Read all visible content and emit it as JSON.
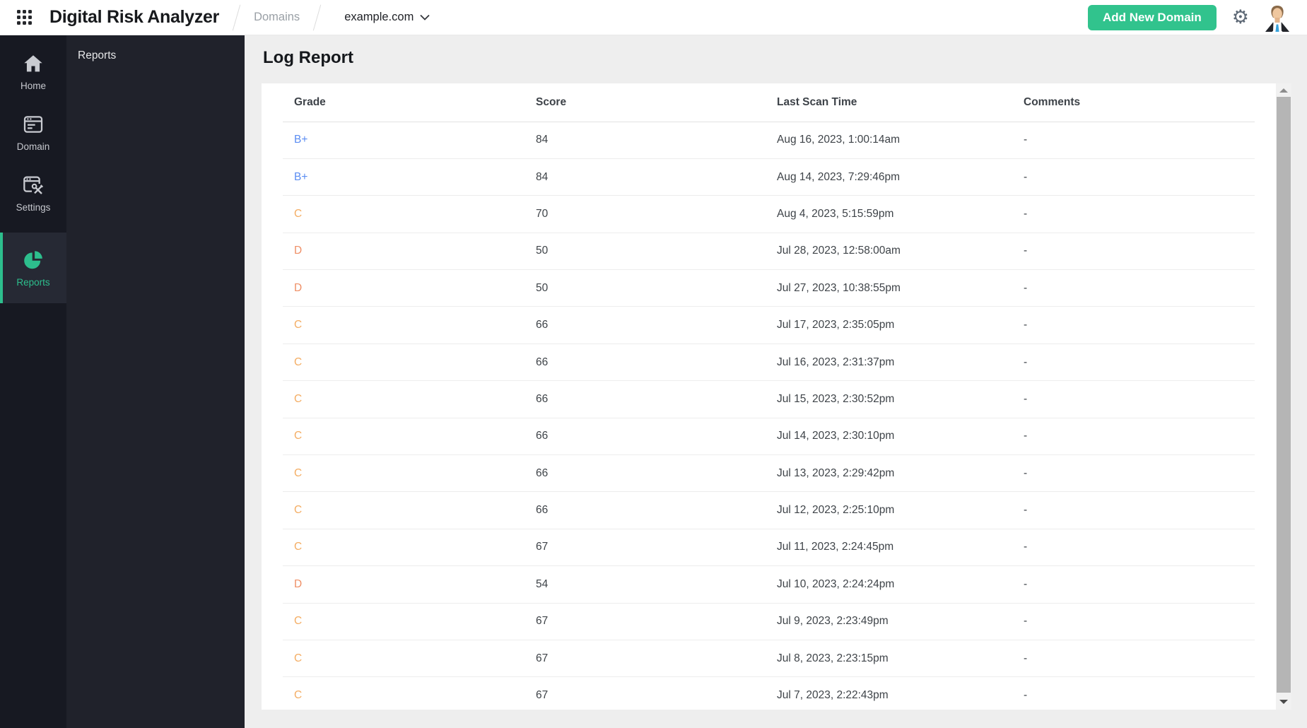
{
  "header": {
    "app_title": "Digital Risk Analyzer",
    "breadcrumb": {
      "section": "Domains",
      "domain": "example.com"
    },
    "add_domain_label": "Add New Domain",
    "gear_glyph": "⚙"
  },
  "sidebar": {
    "items": [
      {
        "label": "Home"
      },
      {
        "label": "Domain"
      },
      {
        "label": "Settings"
      },
      {
        "label": "Reports",
        "active": true
      }
    ]
  },
  "panel": {
    "title": "Reports"
  },
  "main": {
    "title": "Log Report"
  },
  "table": {
    "columns": [
      "Grade",
      "Score",
      "Last Scan Time",
      "Comments"
    ],
    "rows": [
      {
        "grade": "B+",
        "score": "84",
        "time": "Aug 16, 2023, 1:00:14am",
        "comments": "-"
      },
      {
        "grade": "B+",
        "score": "84",
        "time": "Aug 14, 2023, 7:29:46pm",
        "comments": "-"
      },
      {
        "grade": "C",
        "score": "70",
        "time": "Aug 4, 2023, 5:15:59pm",
        "comments": "-"
      },
      {
        "grade": "D",
        "score": "50",
        "time": "Jul 28, 2023, 12:58:00am",
        "comments": "-"
      },
      {
        "grade": "D",
        "score": "50",
        "time": "Jul 27, 2023, 10:38:55pm",
        "comments": "-"
      },
      {
        "grade": "C",
        "score": "66",
        "time": "Jul 17, 2023, 2:35:05pm",
        "comments": "-"
      },
      {
        "grade": "C",
        "score": "66",
        "time": "Jul 16, 2023, 2:31:37pm",
        "comments": "-"
      },
      {
        "grade": "C",
        "score": "66",
        "time": "Jul 15, 2023, 2:30:52pm",
        "comments": "-"
      },
      {
        "grade": "C",
        "score": "66",
        "time": "Jul 14, 2023, 2:30:10pm",
        "comments": "-"
      },
      {
        "grade": "C",
        "score": "66",
        "time": "Jul 13, 2023, 2:29:42pm",
        "comments": "-"
      },
      {
        "grade": "C",
        "score": "66",
        "time": "Jul 12, 2023, 2:25:10pm",
        "comments": "-"
      },
      {
        "grade": "C",
        "score": "67",
        "time": "Jul 11, 2023, 2:24:45pm",
        "comments": "-"
      },
      {
        "grade": "D",
        "score": "54",
        "time": "Jul 10, 2023, 2:24:24pm",
        "comments": "-"
      },
      {
        "grade": "C",
        "score": "67",
        "time": "Jul 9, 2023, 2:23:49pm",
        "comments": "-"
      },
      {
        "grade": "C",
        "score": "67",
        "time": "Jul 8, 2023, 2:23:15pm",
        "comments": "-"
      },
      {
        "grade": "C",
        "score": "67",
        "time": "Jul 7, 2023, 2:22:43pm",
        "comments": "-"
      }
    ]
  },
  "colors": {
    "accent_green": "#31c38d",
    "sidebar_active_green": "#2dbe8d",
    "grade": {
      "B+": "#5b8df2",
      "C": "#f4ad63",
      "D": "#ef8f66"
    }
  }
}
